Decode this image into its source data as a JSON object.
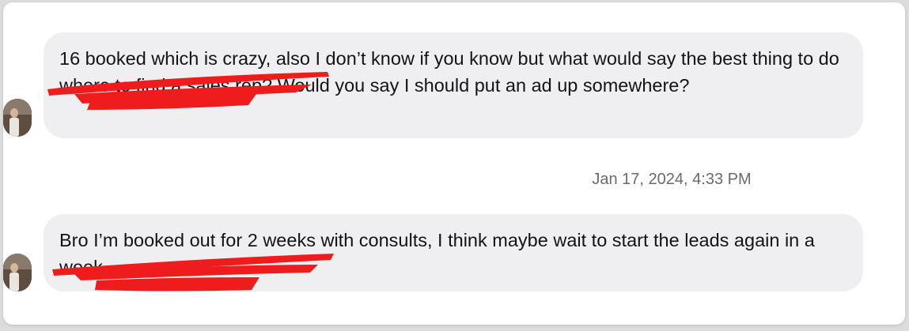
{
  "messages": [
    {
      "text": "16 booked which is crazy, also I don’t know if you know but what would say the best thing to do where to find a sales rep? Would you say I should put an ad up somewhere?"
    },
    {
      "text": "Bro I’m booked out for 2 weeks with consults, I think maybe wait to start the leads again in a week"
    }
  ],
  "timestamp": "Jan 17, 2024, 4:33 PM",
  "colors": {
    "bubble": "#efeef0",
    "redaction": "#ee1c1c",
    "timestamp": "#6a6a6e"
  }
}
